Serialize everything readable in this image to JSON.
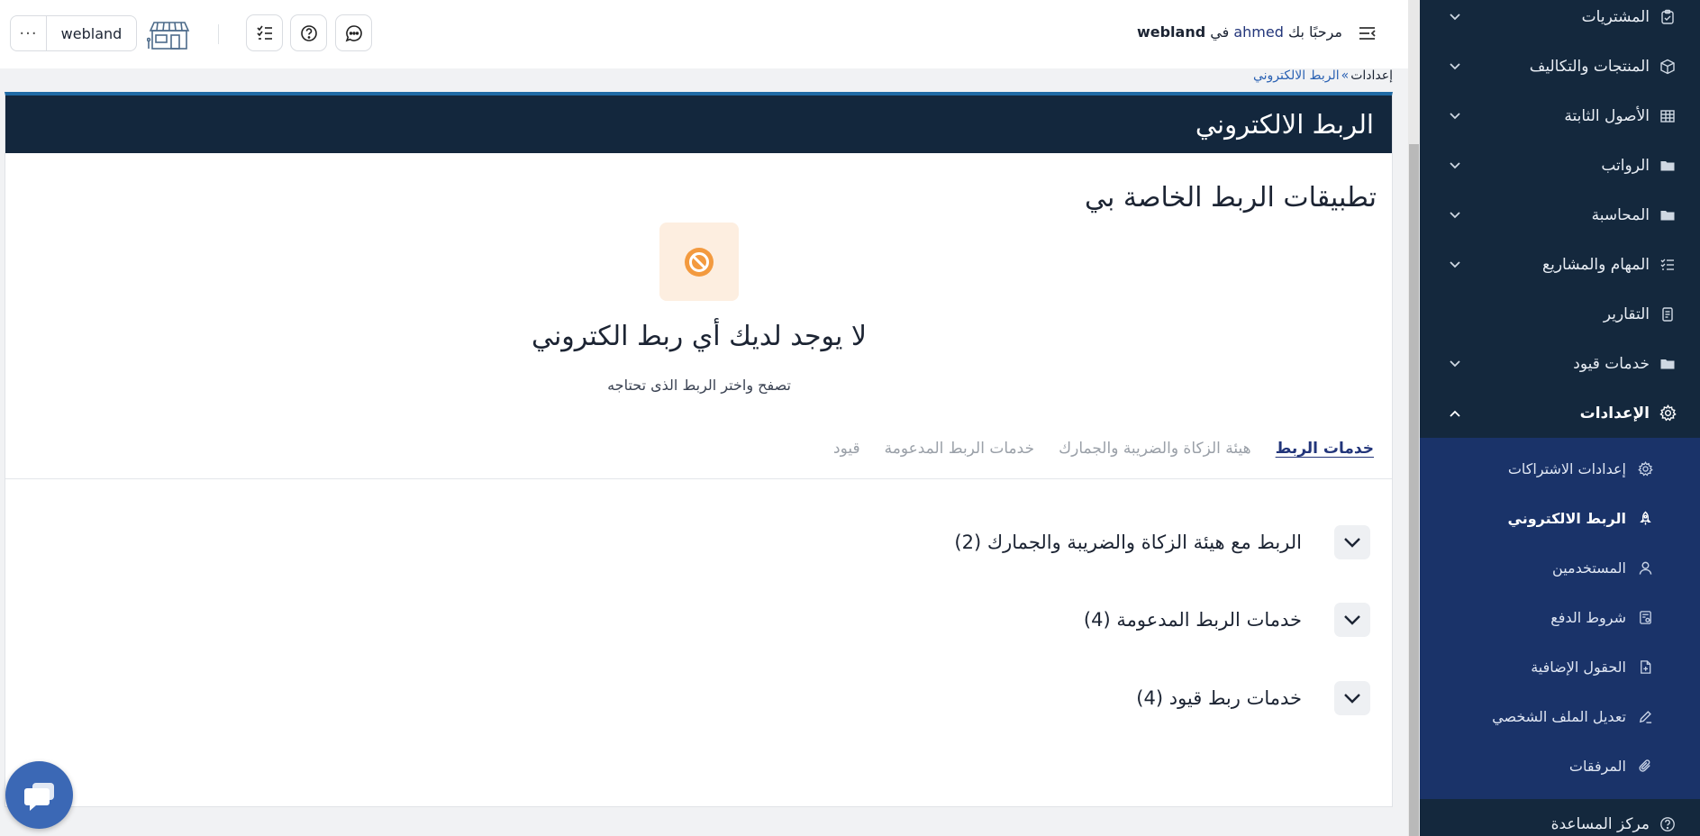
{
  "header": {
    "welcome_prefix": "مرحبًا بك",
    "user_name": "ahmed",
    "welcome_in": "في",
    "company_name": "webland",
    "company_button_label": "webland",
    "more_label": "···"
  },
  "breadcrumb": {
    "root": "إعدادات",
    "separator": "»",
    "current": "الربط الالكتروني"
  },
  "sidebar": {
    "items": [
      {
        "label": "المشتريات",
        "icon": "clipboard-check-icon"
      },
      {
        "label": "المنتجات والتكاليف",
        "icon": "box-icon"
      },
      {
        "label": "الأصول الثابتة",
        "icon": "table-icon"
      },
      {
        "label": "الرواتب",
        "icon": "folder-icon"
      },
      {
        "label": "المحاسبة",
        "icon": "folder-icon"
      },
      {
        "label": "المهام والمشاريع",
        "icon": "tasks-icon"
      },
      {
        "label": "التقارير",
        "icon": "report-icon"
      },
      {
        "label": "خدمات قيود",
        "icon": "folder-icon"
      },
      {
        "label": "الإعدادات",
        "icon": "gear-icon"
      }
    ],
    "submenu": [
      {
        "label": "إعدادات الاشتراكات",
        "icon": "gear-icon"
      },
      {
        "label": "الربط الالكتروني",
        "icon": "rocket-icon"
      },
      {
        "label": "المستخدمين",
        "icon": "user-icon"
      },
      {
        "label": "شروط الدفع",
        "icon": "invoice-icon"
      },
      {
        "label": "الحقول الإضافية",
        "icon": "file-plus-icon"
      },
      {
        "label": "تعديل الملف الشخصي",
        "icon": "pencil-icon"
      },
      {
        "label": "المرفقات",
        "icon": "paperclip-icon"
      }
    ],
    "help_center": {
      "label": "مركز المساعدة",
      "icon": "question-circle-icon"
    }
  },
  "page": {
    "card_title": "الربط الالكتروني",
    "section_title": "تطبيقات الربط الخاصة بي",
    "empty_icon": "ban-icon",
    "empty_title": "لا يوجد لديك أي ربط الكتروني",
    "empty_subtitle": "تصفح واختر الربط الذى تحتاجه"
  },
  "tabs": [
    {
      "label": "خدمات الربط",
      "active": true
    },
    {
      "label": "هيئة الزكاة والضريبة والجمارك",
      "active": false
    },
    {
      "label": "خدمات الربط المدعومة",
      "active": false
    },
    {
      "label": "قيود",
      "active": false
    }
  ],
  "accordions": [
    {
      "label": "الربط مع هيئة الزكاة والضريبة والجمارك (2)"
    },
    {
      "label": "خدمات الربط المدعومة (4)"
    },
    {
      "label": "خدمات ربط قيود (4)"
    }
  ],
  "colors": {
    "sidebar_bg": "#14283d",
    "submenu_bg": "#1a3369",
    "card_header_bg": "#13273d",
    "accent_blue": "#22357a",
    "empty_icon_color": "#f39a3f",
    "chat_button": "#3b68b5"
  }
}
